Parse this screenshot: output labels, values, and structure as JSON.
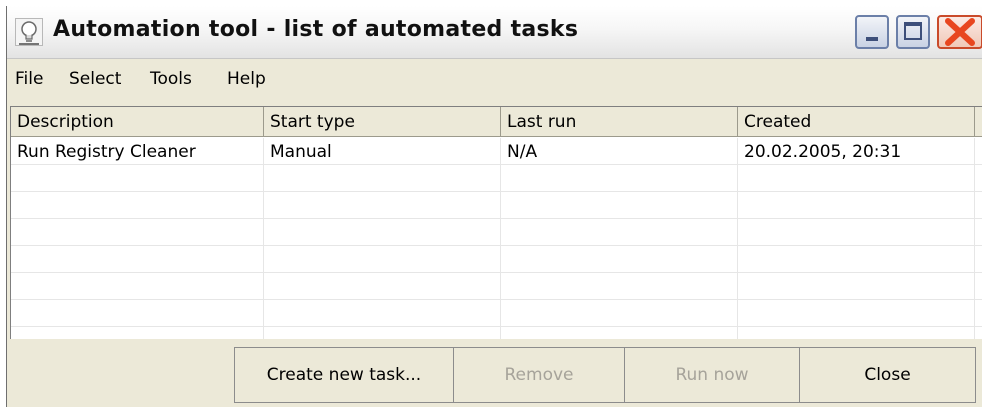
{
  "window": {
    "title": "Automation tool - list of automated tasks",
    "icon": "lightbulb-icon",
    "controls": [
      "minimize-icon",
      "maximize-icon",
      "close-icon"
    ],
    "close_color": "#e8461f"
  },
  "menu": [
    "File",
    "Select",
    "Tools",
    "Help"
  ],
  "table": {
    "columns": [
      "Description",
      "Start type",
      "Last run",
      "Created"
    ],
    "rows": [
      [
        "Run Registry Cleaner",
        "Manual",
        "N/A",
        "20.02.2005, 20:31"
      ]
    ]
  },
  "buttons": {
    "create": {
      "label": "Create new task...",
      "enabled": true
    },
    "remove": {
      "label": "Remove",
      "enabled": false
    },
    "run_now": {
      "label": "Run now",
      "enabled": false
    },
    "close": {
      "label": "Close",
      "enabled": true
    }
  }
}
